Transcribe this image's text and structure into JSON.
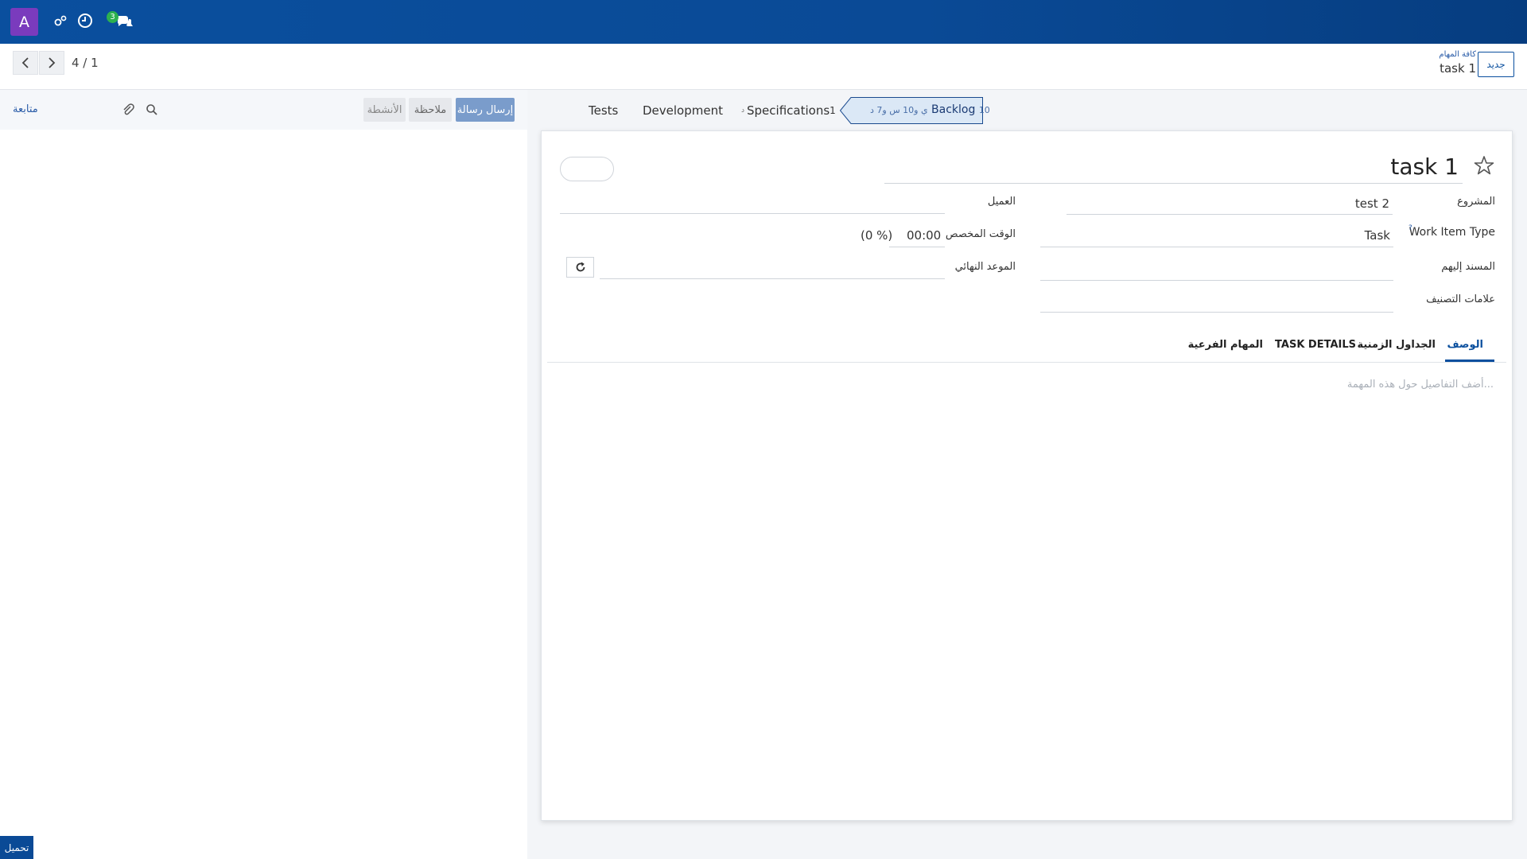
{
  "navbar": {
    "avatar_letter": "A",
    "chat_count": "3"
  },
  "control": {
    "pager_value": "4 / 1",
    "new_label": "جديد",
    "breadcrumb_parent": "كافة المهام",
    "breadcrumb_current": "task 1"
  },
  "chatter": {
    "follow_label": "متابعة",
    "send_message": "إرسال رسالة",
    "log_note": "ملاحظة",
    "activities": "الأنشطة",
    "upload": "تحميل"
  },
  "stages": {
    "tests": "Tests",
    "development": "Development",
    "specifications": "Specifications",
    "specifications_count": "1",
    "specifications_suffix": "د",
    "backlog": "Backlog",
    "backlog_count": "10",
    "backlog_time": "ي و10 س و7 د"
  },
  "form": {
    "title": "task 1",
    "project_label": "المشروع",
    "project_value": "test 2",
    "work_item_type_label": "Work Item Type",
    "work_item_help": "?",
    "work_item_type_value": "Task",
    "assignees_label": "المسند إليهم",
    "tags_label": "علامات التصنيف",
    "customer_label": "العميل",
    "allocated_time_label": "الوقت المخصص",
    "allocated_time_value": "00:00",
    "allocated_percent": "(0 %)",
    "deadline_label": "الموعد النهائي"
  },
  "tabs": {
    "description": "الوصف",
    "timesheets": "الجداول الزمنية",
    "task_details": "TASK DETAILS",
    "subtasks": "المهام الفرعية"
  },
  "description_placeholder": "أضف التفاصيل حول هذه المهمة...",
  "colors": {
    "navbar": "#0a4f9e",
    "avatar": "#7a3bbd",
    "badge": "#2db14f",
    "send_button": "#7a9ccb",
    "accent": "#0a4f9e"
  }
}
